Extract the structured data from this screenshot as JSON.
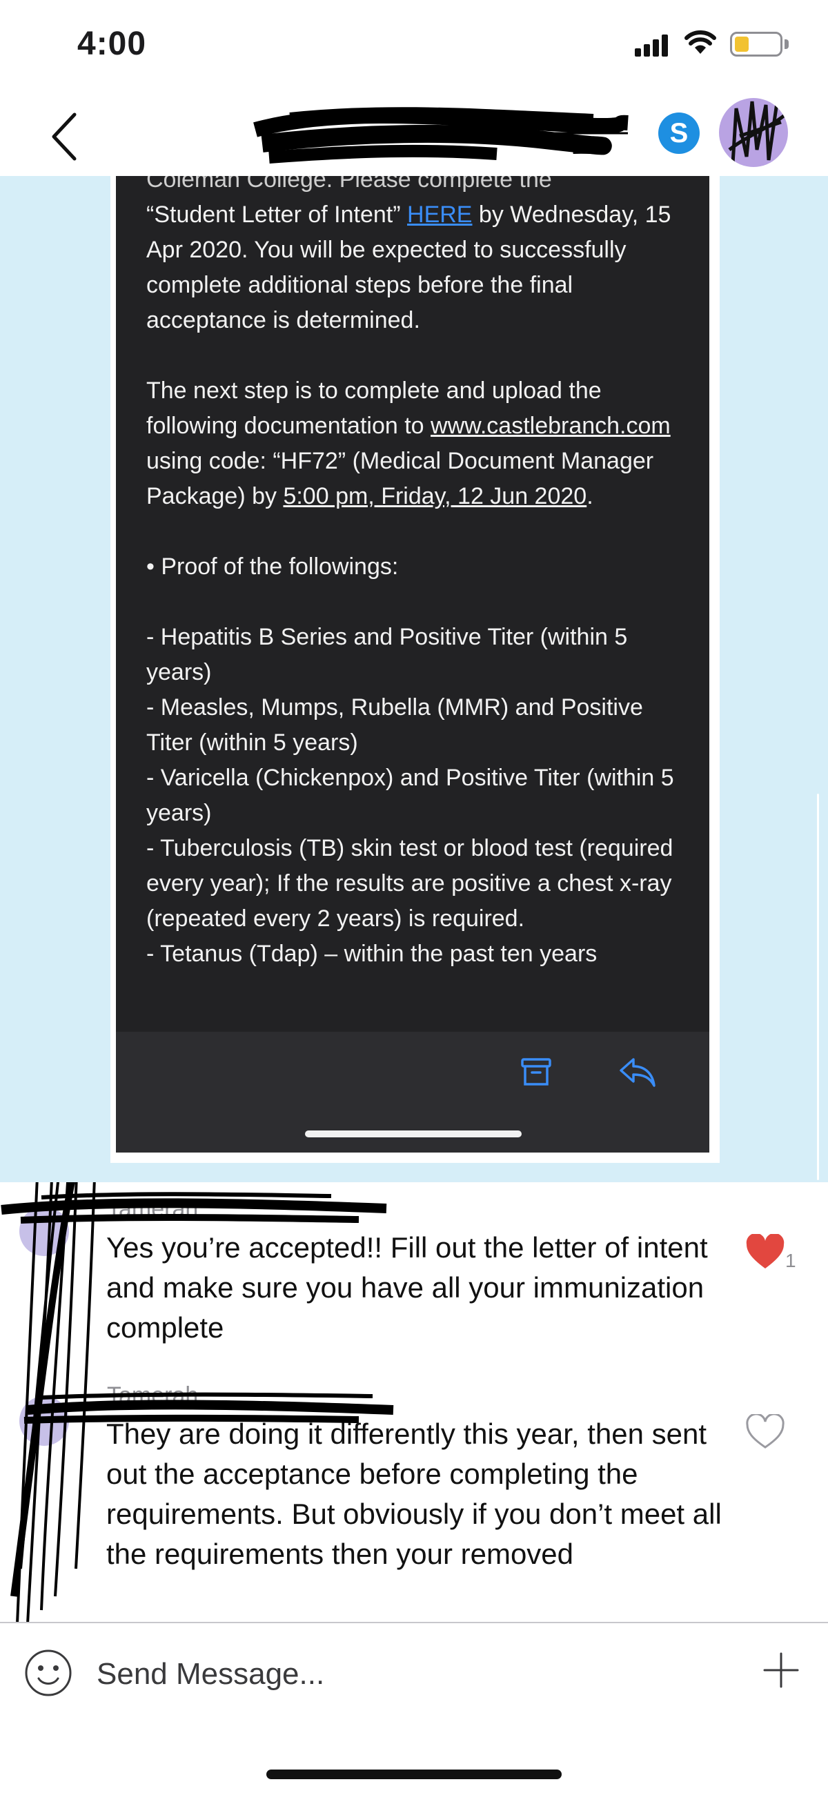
{
  "status_bar": {
    "time": "4:00"
  },
  "nav": {
    "title": "",
    "skype_letter": "S",
    "icons": [
      "back-chevron-icon",
      "skype-icon",
      "avatar"
    ]
  },
  "shared_email": {
    "cut_top_line": "Coleman College. Please complete the",
    "p1_a": "“Student Letter of Intent” ",
    "p1_link": "HERE",
    "p1_b": " by Wednesday, 15 Apr 2020. You will be expected to successfully complete additional steps before the final acceptance is determined.",
    "p2_a": "The next step is to complete and upload the following documentation to ",
    "p2_url": "www.castlebranch.com",
    "p2_b": " using code: “HF72” (Medical Document Manager Package) by ",
    "p2_deadline": "5:00 pm, Friday, 12 Jun 2020",
    "p2_c": ".",
    "proof_heading": "• Proof of the followings:",
    "requirements": [
      "- Hepatitis B Series and Positive Titer (within 5 years)",
      "- Measles, Mumps, Rubella (MMR) and Positive Titer (within 5 years)",
      "- Varicella (Chickenpox) and Positive Titer (within 5 years)",
      "- Tuberculosis (TB) skin test or blood test (required every year); If the results are positive a chest x-ray (repeated every 2 years) is required.",
      "- Tetanus (Tdap) – within the past ten years"
    ],
    "toolbar_icons": [
      "archive-icon",
      "reply-icon"
    ]
  },
  "messages": [
    {
      "sender": "Tamerah",
      "text": "Yes you’re accepted!! Fill out the letter of intent and make sure you have all your immunization complete",
      "liked": true,
      "like_count": "1"
    },
    {
      "sender": "Tamerah",
      "text": "They are doing it differently this year, then sent out the acceptance before completing the requirements. But obviously if you don’t meet all the requirements then your removed",
      "liked": false,
      "like_count": ""
    }
  ],
  "composer": {
    "placeholder": "Send Message...",
    "icons": [
      "emoji-icon",
      "plus-icon"
    ]
  },
  "colors": {
    "accent": "#3a8df7",
    "heart": "#e2473f",
    "shared_bg": "#d6eef8",
    "email_bg": "#222224",
    "skype": "#1e8fe1"
  }
}
